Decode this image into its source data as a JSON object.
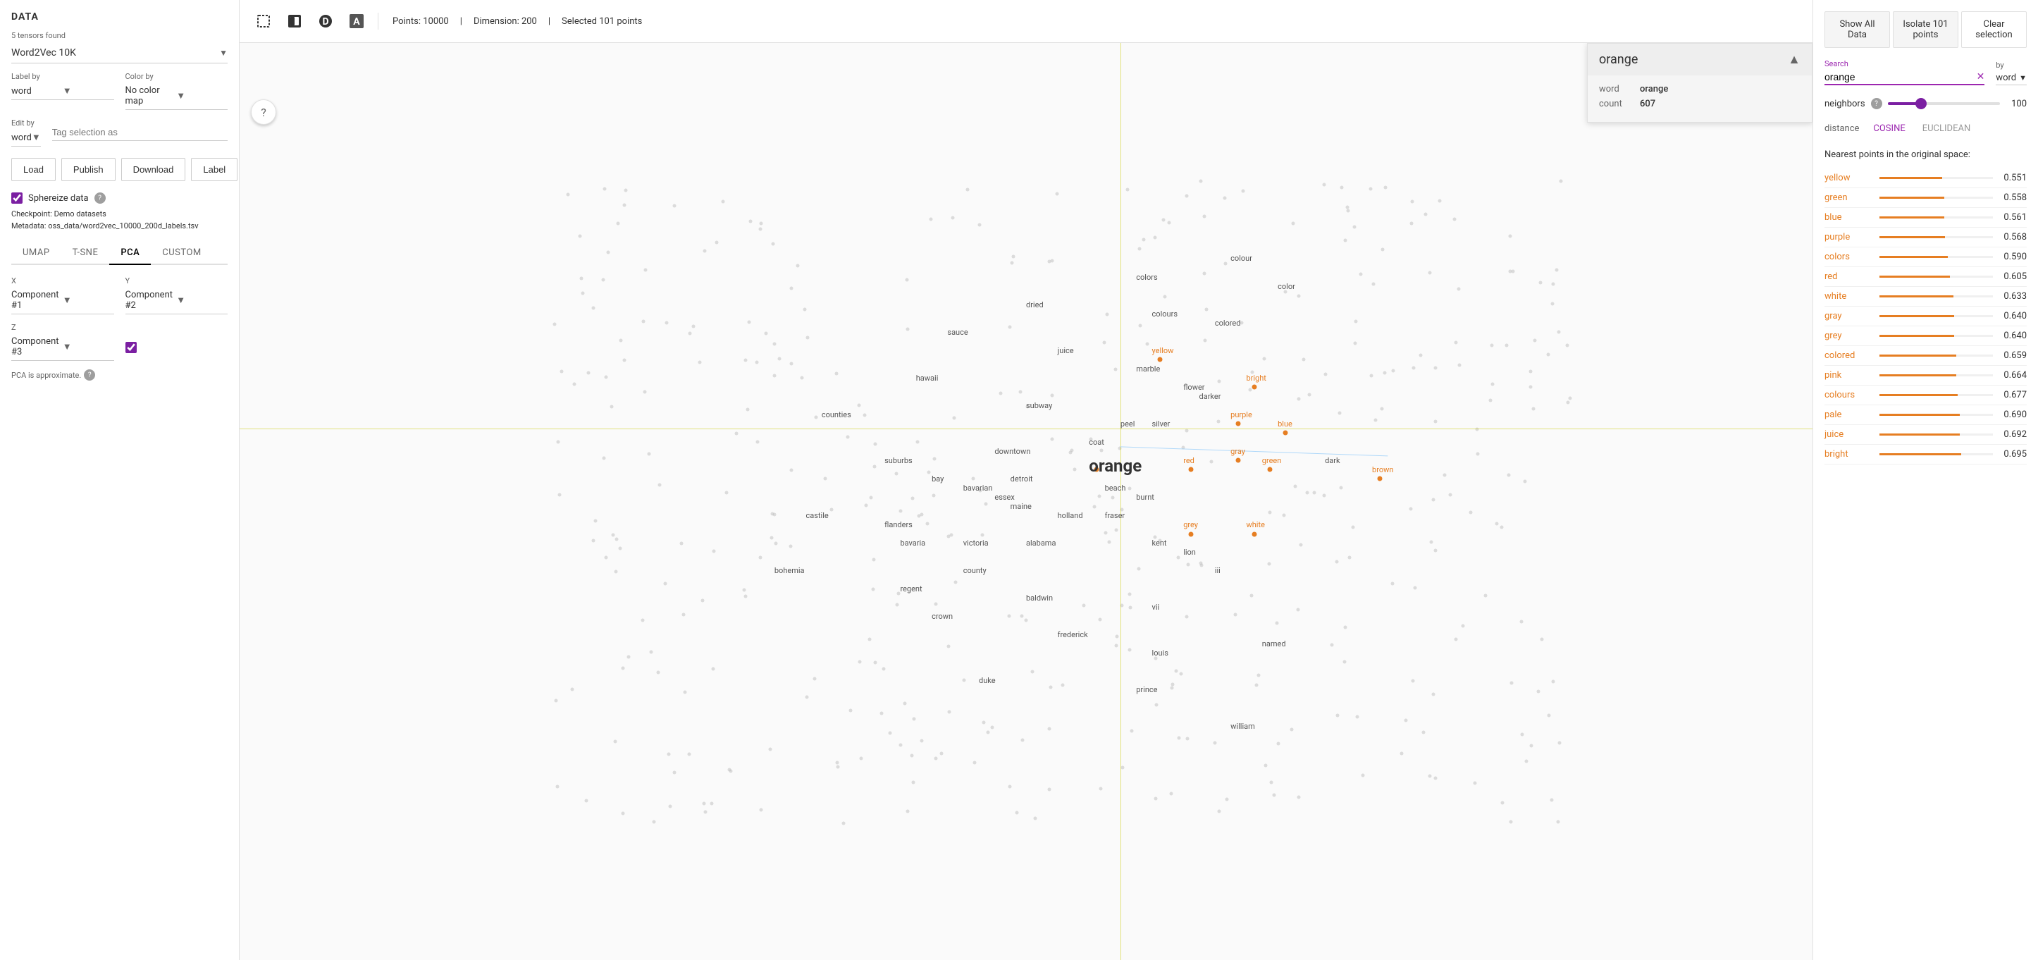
{
  "app": {
    "title": "DATA"
  },
  "left_panel": {
    "title": "DATA",
    "tensors_found_label": "5 tensors found",
    "dataset_value": "Word2Vec 10K",
    "label_by_label": "Label by",
    "label_by_value": "word",
    "color_by_label": "Color by",
    "color_by_value": "No color map",
    "edit_by_label": "Edit by",
    "edit_by_value": "word",
    "tag_selection_placeholder": "Tag selection as",
    "buttons": {
      "load": "Load",
      "publish": "Publish",
      "download": "Download",
      "label": "Label"
    },
    "sphereize_label": "Sphereize data",
    "checkpoint_label": "Checkpoint:",
    "checkpoint_value": "Demo datasets",
    "metadata_label": "Metadata:",
    "metadata_value": "oss_data/word2vec_10000_200d_labels.tsv"
  },
  "tabs": {
    "items": [
      "UMAP",
      "T-SNE",
      "PCA",
      "CUSTOM"
    ],
    "active": "PCA"
  },
  "pca": {
    "x_label": "X",
    "x_value": "Component #1",
    "y_label": "Y",
    "y_value": "Component #2",
    "z_label": "Z",
    "z_value": "Component #3",
    "note": "PCA is approximate."
  },
  "toolbar": {
    "points_text": "Points: 10000",
    "dimension_text": "Dimension: 200",
    "selected_text": "Selected 101 points"
  },
  "right_panel": {
    "show_all_label": "Show All Data",
    "isolate_label": "Isolate 101 points",
    "clear_label": "Clear selection",
    "search_label": "Search",
    "search_value": "orange",
    "by_label": "by",
    "by_value": "word",
    "neighbors_label": "neighbors",
    "neighbors_value": "100",
    "distance_label": "distance",
    "cosine_label": "COSINE",
    "euclidean_label": "EUCLIDEAN",
    "nearest_title": "Nearest points in the original space:",
    "nearest_items": [
      {
        "word": "yellow",
        "value": "0.551",
        "pct": 55
      },
      {
        "word": "green",
        "value": "0.558",
        "pct": 57
      },
      {
        "word": "blue",
        "value": "0.561",
        "pct": 57
      },
      {
        "word": "purple",
        "value": "0.568",
        "pct": 58
      },
      {
        "word": "colors",
        "value": "0.590",
        "pct": 60
      },
      {
        "word": "red",
        "value": "0.605",
        "pct": 62
      },
      {
        "word": "white",
        "value": "0.633",
        "pct": 65
      },
      {
        "word": "gray",
        "value": "0.640",
        "pct": 66
      },
      {
        "word": "grey",
        "value": "0.640",
        "pct": 66
      },
      {
        "word": "colored",
        "value": "0.659",
        "pct": 68
      },
      {
        "word": "pink",
        "value": "0.664",
        "pct": 68
      },
      {
        "word": "colours",
        "value": "0.677",
        "pct": 69
      },
      {
        "word": "pale",
        "value": "0.690",
        "pct": 71
      },
      {
        "word": "juice",
        "value": "0.692",
        "pct": 71
      },
      {
        "word": "bright",
        "value": "0.695",
        "pct": 72
      }
    ]
  },
  "info_popup": {
    "title": "orange",
    "word_label": "word",
    "word_value": "orange",
    "count_label": "count",
    "count_value": "607"
  },
  "scatter_words": [
    {
      "text": "colors",
      "x": 57,
      "y": 25,
      "type": "normal"
    },
    {
      "text": "colour",
      "x": 63,
      "y": 23,
      "type": "normal"
    },
    {
      "text": "color",
      "x": 66,
      "y": 26,
      "type": "normal"
    },
    {
      "text": "dried",
      "x": 50,
      "y": 28,
      "type": "normal"
    },
    {
      "text": "colours",
      "x": 58,
      "y": 29,
      "type": "normal"
    },
    {
      "text": "colored",
      "x": 62,
      "y": 30,
      "type": "normal"
    },
    {
      "text": "sauce",
      "x": 45,
      "y": 31,
      "type": "normal"
    },
    {
      "text": "juice",
      "x": 52,
      "y": 33,
      "type": "normal"
    },
    {
      "text": "marble",
      "x": 57,
      "y": 35,
      "type": "normal"
    },
    {
      "text": "yellow",
      "x": 58,
      "y": 33,
      "type": "orange"
    },
    {
      "text": "hawaii",
      "x": 43,
      "y": 36,
      "type": "normal"
    },
    {
      "text": "flower",
      "x": 60,
      "y": 37,
      "type": "normal"
    },
    {
      "text": "darker",
      "x": 61,
      "y": 38,
      "type": "normal"
    },
    {
      "text": "bright",
      "x": 64,
      "y": 36,
      "type": "orange"
    },
    {
      "text": "purple",
      "x": 63,
      "y": 40,
      "type": "orange"
    },
    {
      "text": "subway",
      "x": 50,
      "y": 39,
      "type": "normal"
    },
    {
      "text": "blue",
      "x": 66,
      "y": 41,
      "type": "orange"
    },
    {
      "text": "silver",
      "x": 58,
      "y": 41,
      "type": "normal"
    },
    {
      "text": "peel",
      "x": 56,
      "y": 41,
      "type": "normal"
    },
    {
      "text": "coat",
      "x": 54,
      "y": 43,
      "type": "normal"
    },
    {
      "text": "counties",
      "x": 37,
      "y": 40,
      "type": "normal"
    },
    {
      "text": "gray",
      "x": 63,
      "y": 44,
      "type": "orange"
    },
    {
      "text": "red",
      "x": 60,
      "y": 45,
      "type": "orange"
    },
    {
      "text": "suburbs",
      "x": 41,
      "y": 45,
      "type": "normal"
    },
    {
      "text": "downtown",
      "x": 48,
      "y": 44,
      "type": "normal"
    },
    {
      "text": "green",
      "x": 65,
      "y": 45,
      "type": "orange"
    },
    {
      "text": "dark",
      "x": 69,
      "y": 45,
      "type": "normal"
    },
    {
      "text": "detroit",
      "x": 49,
      "y": 47,
      "type": "normal"
    },
    {
      "text": "bay",
      "x": 44,
      "y": 47,
      "type": "normal"
    },
    {
      "text": "beach",
      "x": 55,
      "y": 48,
      "type": "normal"
    },
    {
      "text": "burnt",
      "x": 57,
      "y": 49,
      "type": "normal"
    },
    {
      "text": "brown",
      "x": 72,
      "y": 46,
      "type": "orange"
    },
    {
      "text": "orange",
      "x": 54,
      "y": 45,
      "type": "highlighted"
    },
    {
      "text": "essex",
      "x": 48,
      "y": 49,
      "type": "normal"
    },
    {
      "text": "bavarian",
      "x": 46,
      "y": 48,
      "type": "normal"
    },
    {
      "text": "maine",
      "x": 49,
      "y": 50,
      "type": "normal"
    },
    {
      "text": "holland",
      "x": 52,
      "y": 51,
      "type": "normal"
    },
    {
      "text": "fraser",
      "x": 55,
      "y": 51,
      "type": "normal"
    },
    {
      "text": "grey",
      "x": 60,
      "y": 52,
      "type": "orange"
    },
    {
      "text": "castile",
      "x": 36,
      "y": 51,
      "type": "normal"
    },
    {
      "text": "flanders",
      "x": 41,
      "y": 52,
      "type": "normal"
    },
    {
      "text": "bavaria",
      "x": 42,
      "y": 54,
      "type": "normal"
    },
    {
      "text": "victoria",
      "x": 46,
      "y": 54,
      "type": "normal"
    },
    {
      "text": "alabama",
      "x": 50,
      "y": 54,
      "type": "normal"
    },
    {
      "text": "kent",
      "x": 58,
      "y": 54,
      "type": "normal"
    },
    {
      "text": "white",
      "x": 64,
      "y": 52,
      "type": "orange"
    },
    {
      "text": "county",
      "x": 46,
      "y": 57,
      "type": "normal"
    },
    {
      "text": "lion",
      "x": 60,
      "y": 55,
      "type": "normal"
    },
    {
      "text": "iii",
      "x": 62,
      "y": 57,
      "type": "normal"
    },
    {
      "text": "bohemia",
      "x": 34,
      "y": 57,
      "type": "normal"
    },
    {
      "text": "regent",
      "x": 42,
      "y": 59,
      "type": "normal"
    },
    {
      "text": "baldwin",
      "x": 50,
      "y": 60,
      "type": "normal"
    },
    {
      "text": "vii",
      "x": 58,
      "y": 61,
      "type": "normal"
    },
    {
      "text": "crown",
      "x": 44,
      "y": 62,
      "type": "normal"
    },
    {
      "text": "frederick",
      "x": 52,
      "y": 64,
      "type": "normal"
    },
    {
      "text": "louis",
      "x": 58,
      "y": 66,
      "type": "normal"
    },
    {
      "text": "named",
      "x": 65,
      "y": 65,
      "type": "normal"
    },
    {
      "text": "duke",
      "x": 47,
      "y": 69,
      "type": "normal"
    },
    {
      "text": "prince",
      "x": 57,
      "y": 70,
      "type": "normal"
    },
    {
      "text": "william",
      "x": 63,
      "y": 74,
      "type": "normal"
    }
  ]
}
